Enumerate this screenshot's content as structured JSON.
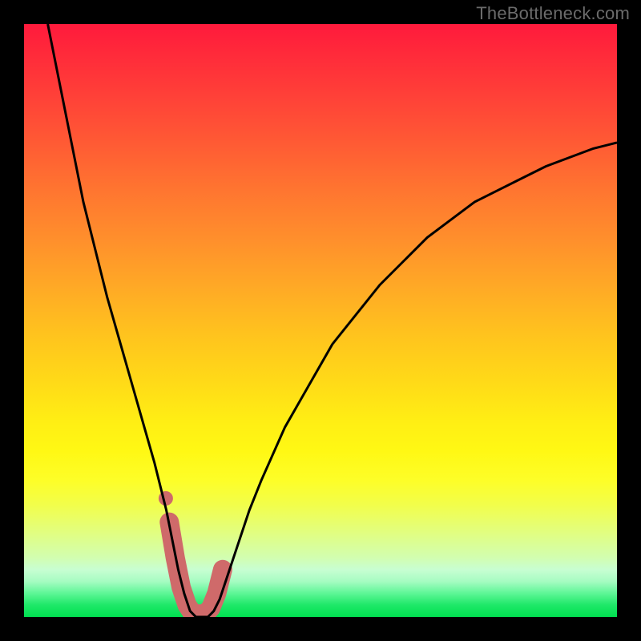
{
  "watermark": "TheBottleneck.com",
  "colors": {
    "frame": "#000000",
    "curve": "#000000",
    "marker": "#cf6a6a",
    "gradient_top": "#ff1a3c",
    "gradient_mid": "#ffee14",
    "gradient_bottom": "#00e050"
  },
  "chart_data": {
    "type": "line",
    "title": "",
    "xlabel": "",
    "ylabel": "",
    "xlim": [
      0,
      100
    ],
    "ylim": [
      0,
      100
    ],
    "grid": false,
    "legend": false,
    "series": [
      {
        "name": "bottleneck-curve",
        "x": [
          4,
          6,
          8,
          10,
          12,
          14,
          16,
          18,
          20,
          22,
          24,
          25,
          26,
          27,
          28,
          29,
          30,
          31,
          32,
          33,
          34,
          36,
          38,
          40,
          44,
          48,
          52,
          56,
          60,
          64,
          68,
          72,
          76,
          80,
          84,
          88,
          92,
          96,
          100
        ],
        "values": [
          100,
          90,
          80,
          70,
          62,
          54,
          47,
          40,
          33,
          26,
          18,
          13,
          8,
          4,
          1,
          0,
          0,
          0,
          1,
          3,
          6,
          12,
          18,
          23,
          32,
          39,
          46,
          51,
          56,
          60,
          64,
          67,
          70,
          72,
          74,
          76,
          77.5,
          79,
          80
        ]
      },
      {
        "name": "minimum-marker",
        "x": [
          24.5,
          25.5,
          26.5,
          27.5,
          28.5,
          29.5,
          30.5,
          31.5,
          32.5,
          33.5
        ],
        "values": [
          16,
          10,
          5,
          2,
          0.5,
          0.5,
          0.5,
          1.5,
          4,
          8
        ]
      }
    ],
    "annotations": [
      {
        "text": "TheBottleneck.com",
        "position": "top-right"
      }
    ]
  }
}
